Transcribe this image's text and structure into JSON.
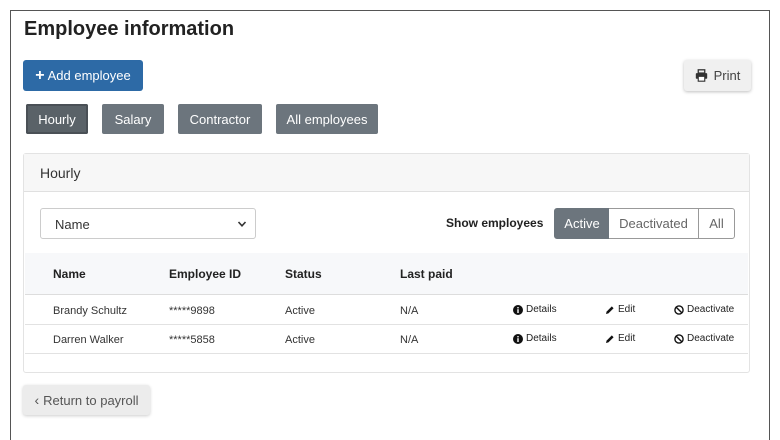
{
  "page": {
    "title": "Employee information"
  },
  "toolbar": {
    "add_label": "Add employee",
    "print_label": "Print"
  },
  "filters": [
    {
      "label": "Hourly",
      "active": true
    },
    {
      "label": "Salary",
      "active": false
    },
    {
      "label": "Contractor",
      "active": false
    },
    {
      "label": "All employees",
      "active": false
    }
  ],
  "card": {
    "title": "Hourly"
  },
  "sort_select": {
    "value": "Name"
  },
  "show_employees": {
    "label": "Show employees",
    "options": [
      "Active",
      "Deactivated",
      "All"
    ],
    "selected": "Active"
  },
  "table": {
    "headers": [
      "Name",
      "Employee ID",
      "Status",
      "Last paid"
    ],
    "rows": [
      {
        "name": "Brandy Schultz",
        "id": "*****9898",
        "status": "Active",
        "last_paid": "N/A"
      },
      {
        "name": "Darren Walker",
        "id": "*****5858",
        "status": "Active",
        "last_paid": "N/A"
      }
    ],
    "actions": {
      "details": "Details",
      "edit": "Edit",
      "deactivate": "Deactivate"
    }
  },
  "footer": {
    "return_label": "Return to payroll"
  },
  "colors": {
    "primary": "#2d6aa6",
    "secondary": "#6c757d",
    "light": "#f7f7f7"
  },
  "icons": [
    "plus-icon",
    "print-icon",
    "chevron-down-icon",
    "info-icon",
    "pencil-icon",
    "ban-icon",
    "chevron-left-icon"
  ]
}
